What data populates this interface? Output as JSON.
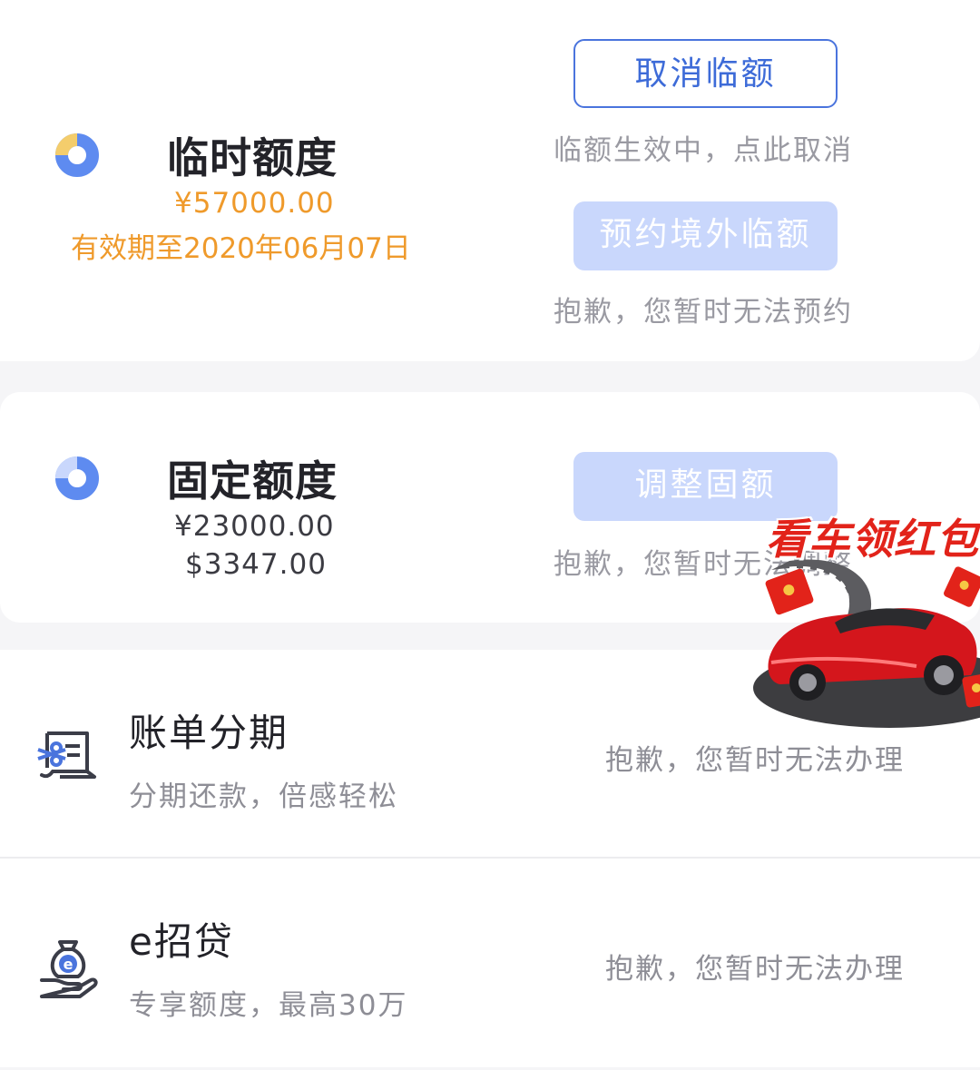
{
  "temp_limit": {
    "title": "临时额度",
    "amount": "¥57000.00",
    "validity": "有效期至2020年06月07日",
    "cancel_button": "取消临额",
    "cancel_note": "临额生效中，点此取消",
    "reserve_button": "预约境外临额",
    "reserve_note": "抱歉，您暂时无法预约"
  },
  "fixed_limit": {
    "title": "固定额度",
    "amount_cny": "¥23000.00",
    "amount_usd": "$3347.00",
    "adjust_button": "调整固额",
    "adjust_note": "抱歉，您暂时无法调整"
  },
  "services": [
    {
      "title": "账单分期",
      "subtitle": "分期还款，倍感轻松",
      "status": "抱歉，您暂时无法办理",
      "icon": "bill-installment-icon"
    },
    {
      "title": "e招贷",
      "subtitle": "专享额度，最高30万",
      "status": "抱歉，您暂时无法办理",
      "icon": "loan-money-bag-icon"
    }
  ],
  "promo": {
    "text": "看车领红包"
  },
  "colors": {
    "accent_blue": "#3d6bd8",
    "disabled_blue": "#c9d7fc",
    "orange": "#ef9a2b",
    "donut_blue": "#5e8bf0",
    "donut_yellow": "#f4cd6c",
    "promo_red": "#e2231a"
  }
}
